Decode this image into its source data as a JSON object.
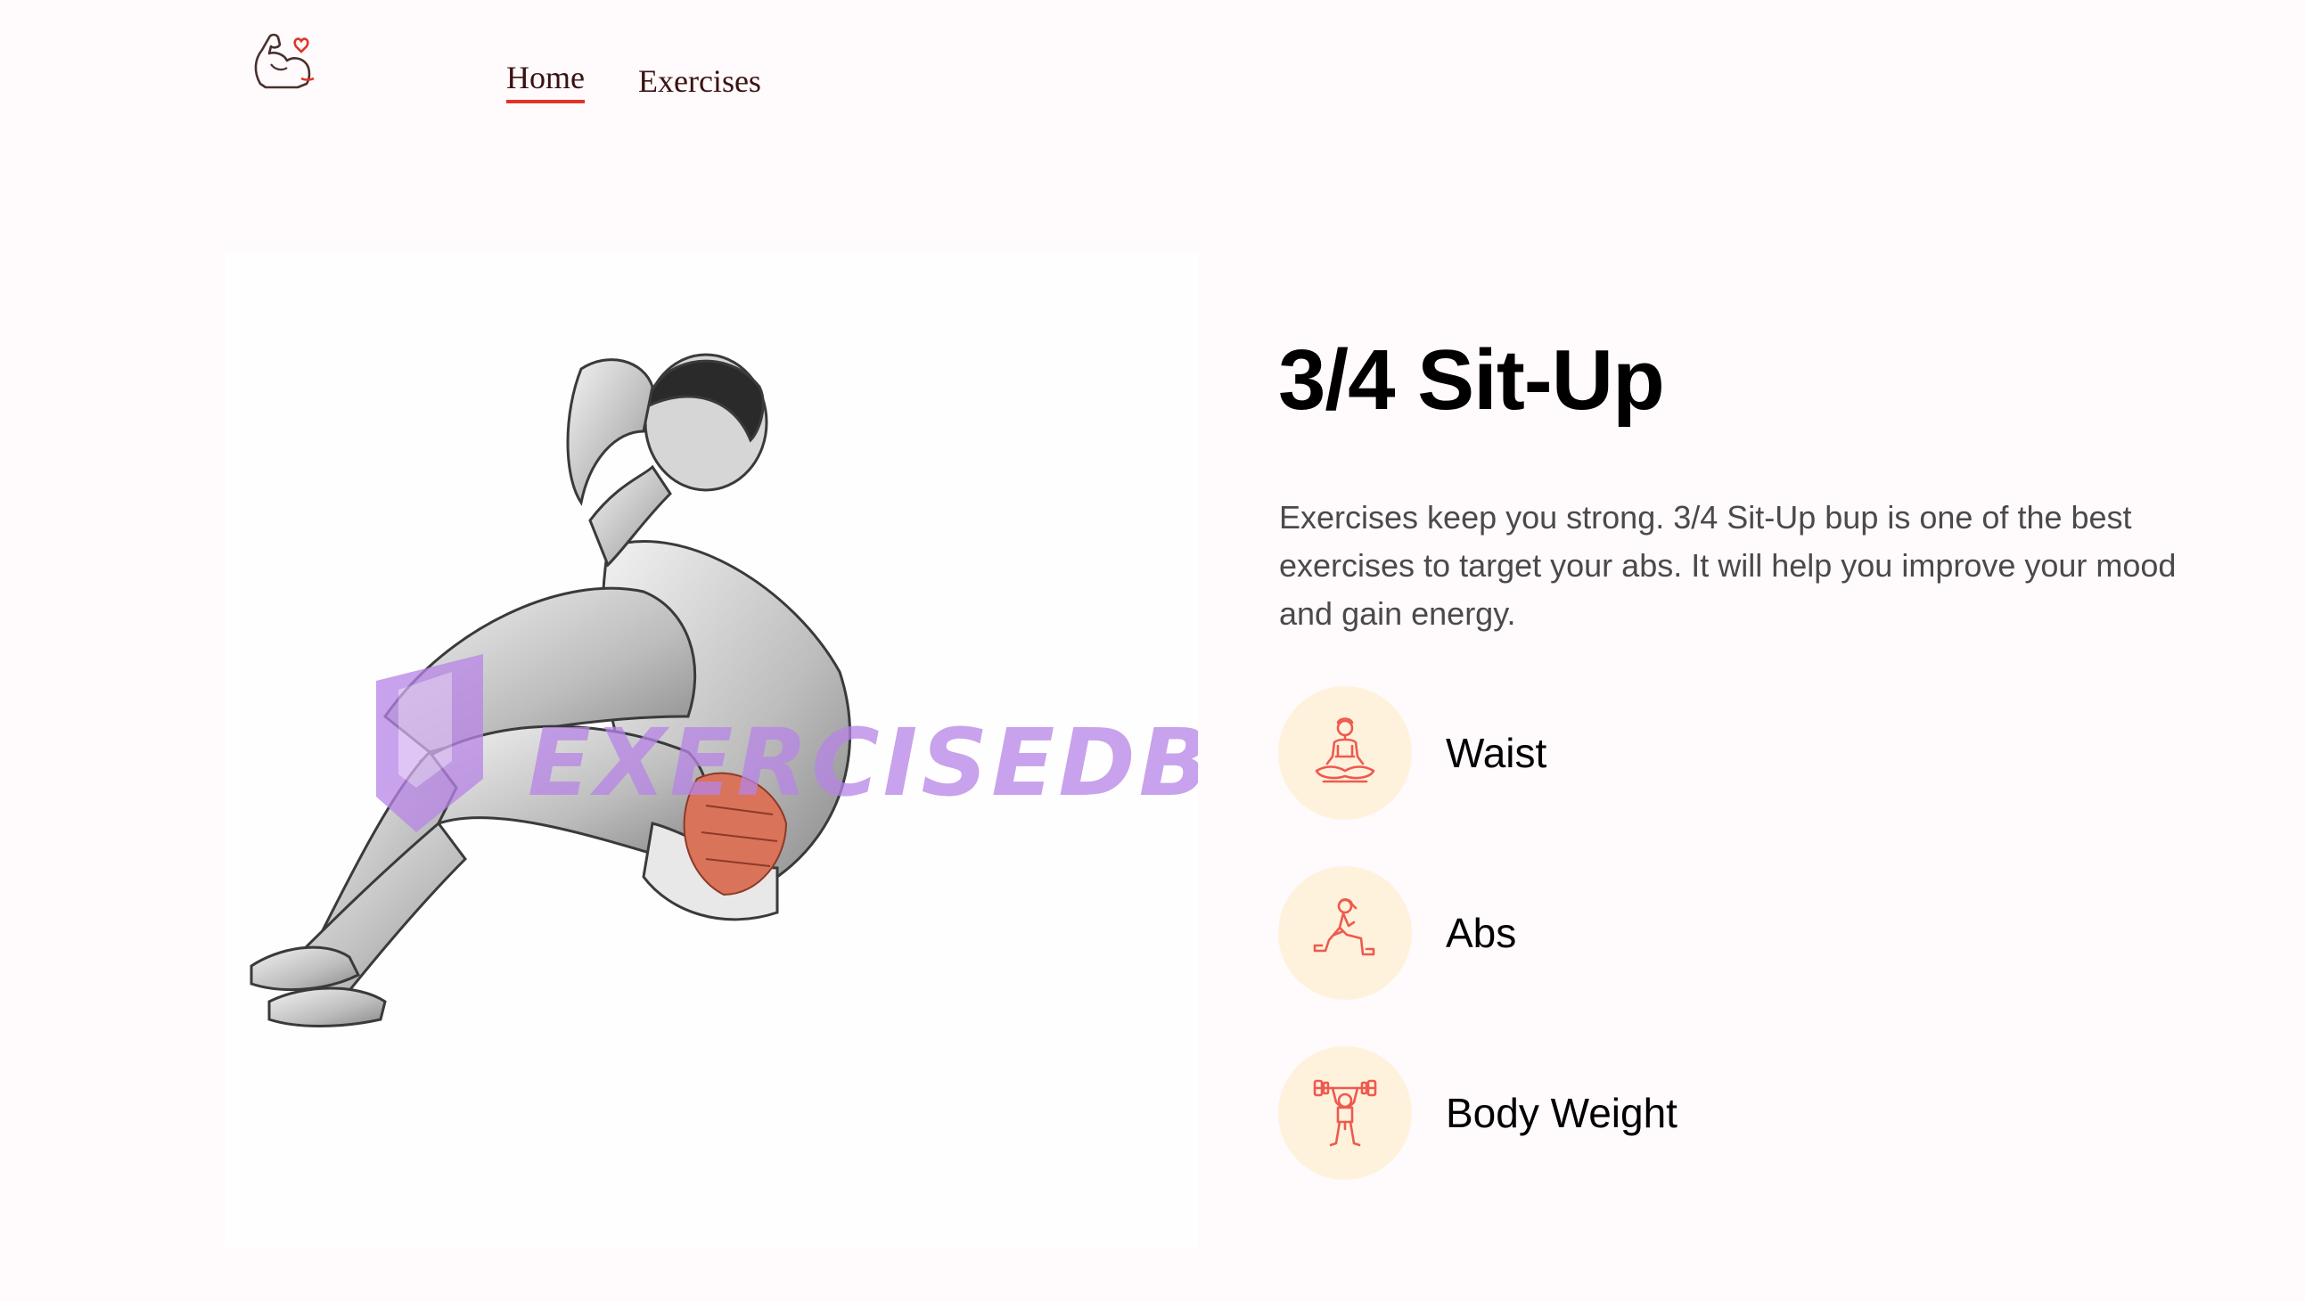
{
  "nav": {
    "logo_icon": "flexed-arm-heart-icon",
    "links": [
      {
        "label": "Home",
        "active": true
      },
      {
        "label": "Exercises",
        "active": false
      }
    ],
    "active_underline_color": "#e0342a"
  },
  "exercise": {
    "name": "3/4 Sit-Up",
    "description": "Exercises keep you strong. 3/4 Sit-Up bup is one of the best exercises to target your abs. It will help you improve your mood and gain energy.",
    "image": {
      "subject": "sit-up-illustration",
      "watermark": "EXERCISEDB",
      "highlight_color": "#d9735a",
      "watermark_color": "#b784e6"
    },
    "details": [
      {
        "icon": "meditation-icon",
        "label": "Waist"
      },
      {
        "icon": "lunge-icon",
        "label": "Abs"
      },
      {
        "icon": "weightlifter-icon",
        "label": "Body Weight"
      }
    ]
  },
  "colors": {
    "page_background": "#fffafb",
    "icon_circle": "#fff2dc",
    "icon_stroke": "#ee5a4f",
    "text_primary": "#000000",
    "text_secondary": "#4a4a4a"
  }
}
